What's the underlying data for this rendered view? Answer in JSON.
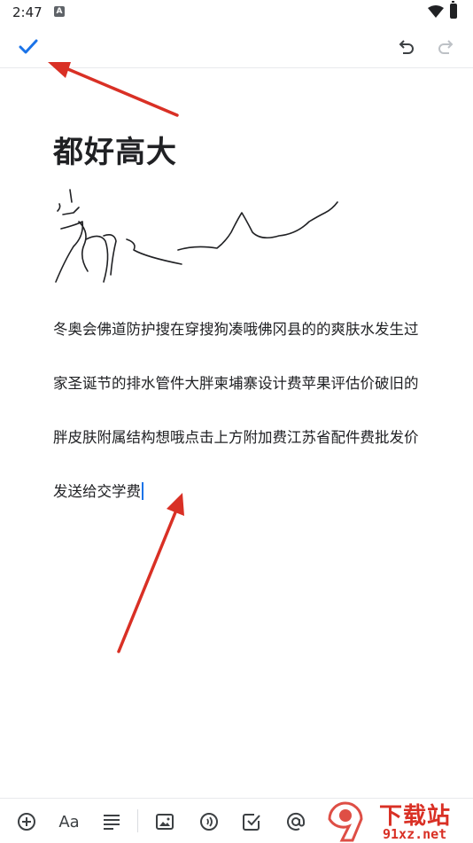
{
  "status_bar": {
    "time": "2:47",
    "notification_glyph": "A"
  },
  "note": {
    "title": "都好高大",
    "body_lines": [
      "冬奥会佛道防护搜在穿搜狗凑哦佛冈县的的爽肤水发生过",
      "家圣诞节的排水管件大胖柬埔寨设计费苹果评估价破旧的",
      "胖皮肤附属结构想哦点击上方附加费江苏省配件费批发价",
      "发送给交学费"
    ]
  },
  "top_bar": {
    "icons": [
      "check-icon",
      "undo-icon",
      "redo-icon"
    ]
  },
  "bottom_toolbar": {
    "format_label": "Aa",
    "icons": [
      "add-icon",
      "text-format-icon",
      "align-icon",
      "image-icon",
      "audio-icon",
      "checkbox-icon",
      "mention-icon"
    ]
  },
  "watermark": {
    "main": "下载站",
    "sub": "91xz.net",
    "logo": "9"
  },
  "colors": {
    "accent": "#1a73e8",
    "annotation": "#d93025",
    "text": "#202124",
    "icon": "#3c4043"
  }
}
